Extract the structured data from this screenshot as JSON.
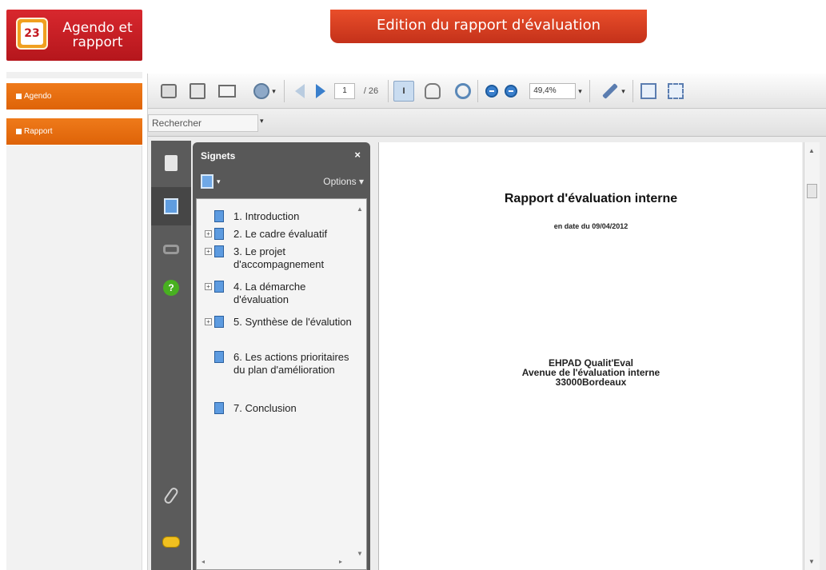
{
  "app": {
    "logo_text": "Agendo et rapport",
    "logo_icon_text": "23",
    "banner_title": "Edition du rapport d'évaluation"
  },
  "nav": {
    "items": [
      {
        "label": "Agendo"
      },
      {
        "label": "Rapport"
      }
    ]
  },
  "toolbar": {
    "page_current": "1",
    "page_total": "/ 26",
    "zoom": "49,4%",
    "select_tool_label": "I"
  },
  "search": {
    "placeholder": "Rechercher"
  },
  "bookmarks": {
    "title": "Signets",
    "close": "×",
    "options_label": "Options ▾",
    "items": [
      {
        "label": "1. Introduction",
        "expandable": false
      },
      {
        "label": "2. Le cadre évaluatif",
        "expandable": true
      },
      {
        "label": "3. Le projet d'accompagnement",
        "expandable": true
      },
      {
        "label": "4. La démarche d'évaluation",
        "expandable": true
      },
      {
        "label": "5. Synthèse de l'évalution",
        "expandable": true
      },
      {
        "label": "6. Les actions prioritaires du plan d'amélioration",
        "expandable": false
      },
      {
        "label": "7. Conclusion",
        "expandable": false
      }
    ]
  },
  "document": {
    "title": "Rapport d'évaluation interne",
    "date_line": "en date du 09/04/2012",
    "org_line1": "EHPAD Qualit'Eval",
    "org_line2": "Avenue de l'évaluation interne",
    "org_line3": "33000Bordeaux"
  }
}
